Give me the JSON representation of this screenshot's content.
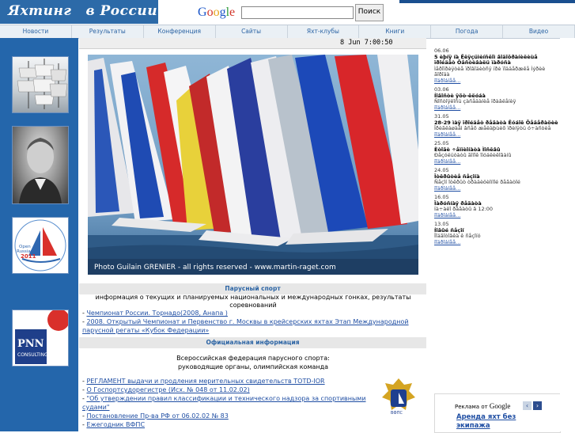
{
  "header": {
    "logo_text_a": "Яхтинг",
    "logo_text_b": "в России",
    "google_logo": "Google",
    "search_placeholder": "",
    "search_button": "Поиск"
  },
  "nav": [
    "Новости",
    "Результаты",
    "Конференция",
    "Сайты",
    "Яхт-клубы",
    "Книги",
    "Погода",
    "Видео"
  ],
  "datebar": {
    "datetime": "8 Jun  7:00:50"
  },
  "photo": {
    "caption": "Photo Guilain GRENIER - all rights reserved - www.martin-raget.com"
  },
  "thumbs": {
    "open_russian_badge": "Open Russian 2011",
    "pnn_logo": "PNN",
    "pnn_sub": "CONSULTING"
  },
  "section1": {
    "title": "Парусный спорт",
    "desc": "информация о текущих и планируемых национальных и международных гонках, результаты соревнований",
    "links": [
      "Чемпионат России. Торнадо(2008, Анапа )",
      "2008. Открытый Чемпионат и Первенство г. Москвы в крейсерских яхтах Этап Международной парусной регаты «Кубок Федерации»"
    ]
  },
  "section2": {
    "title": "Официальная информация",
    "desc": "Всероссийская федерация парусного спорта:\nруководящие органы, олимпийская команда",
    "links": [
      "РЕГЛАМЕНТ выдачи и продления мерительных свидетельств TOTD-IOR",
      "О Госпортсудорегистре (Исх. № 048 от 11.02.02)",
      "\"Об утверждении правил классификации и технического надзора за спортивными судами\"",
      "Постановление Пр-ва РФ от 06.02.02 № 83",
      "Ежегодник ВФПС"
    ],
    "emblem_text": "ВФПС"
  },
  "news": [
    {
      "date": "06.06",
      "head": "5 èþíÿ íà Êëÿçüìèíñêîì âîäîõðàíèëèùå ïðîéäåò Ôåñòèâàëü ïàðóñà",
      "body": "Ìåðîïðèÿòèå ïðîâîäèòñÿ ïðè ïîääåðæêå Ìýðèè ãîðîäà",
      "more": "ïîäðîáíåå..."
    },
    {
      "date": "03.06",
      "head": "Íîâîñòè ÿõò-êëóáà",
      "body": "Ñîñòîÿëîñü çàñåäàíèå ïðàâëåíèÿ",
      "more": "ïîäðîáíåå..."
    },
    {
      "date": "31.05",
      "head": "28-29 ìàÿ ïðîéäåò ðåãàòà Êóáîê Ôåäåðàöèè",
      "body": "Ïðèãëàøàåì âñåõ æåëàþùèõ ïðèíÿòü ó÷àñòèå",
      "more": "ïîäðîáíåå..."
    },
    {
      "date": "25.05",
      "head": "Èòîãè ÷åìïèîíàòà Ìîñêâû",
      "body": "Ðåçóëüòàòû ãîíîê îïóáëèêîâàíû",
      "more": "ïîäðîáíåå..."
    },
    {
      "date": "24.05",
      "head": "Îòêðûòèå ñåçîíà",
      "body": "Ñåçîí îòêðûò òðàäèöèîííîé ðåãàòîé",
      "more": "ïîäðîáíåå..."
    },
    {
      "date": "16.05",
      "head": "Ïàðóñíàÿ ðåãàòà",
      "body": "Íà÷àëî ðåãàòû â 12:00",
      "more": "ïîäðîáíåå..."
    },
    {
      "date": "13.05",
      "head": "Íîâûé ñåçîí",
      "body": "Ïîäãîòîâêà ê ñåçîíó",
      "more": "ïîäðîáíåå..."
    }
  ],
  "ad": {
    "label": "Реклама от",
    "google": "Google",
    "prev": "‹",
    "next": "›",
    "title": "Аренда яхт без экипажа"
  }
}
